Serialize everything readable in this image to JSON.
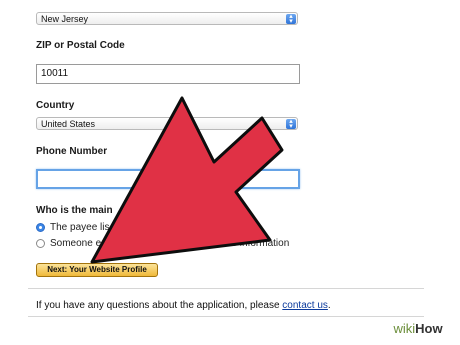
{
  "form": {
    "state_select": {
      "value": "New Jersey"
    },
    "zip": {
      "label": "ZIP or Postal Code",
      "value": "10011"
    },
    "country": {
      "label": "Country",
      "value": "United States"
    },
    "phone": {
      "label": "Phone Number",
      "value": ""
    },
    "question": {
      "label": "Who is the main"
    },
    "options": [
      {
        "label": "The payee lis",
        "selected": true
      },
      {
        "label": "Someone e",
        "suffix": "enter their information",
        "selected": false
      }
    ],
    "next_button": "Next: Your Website Profile"
  },
  "footer": {
    "text_before": "If you have any questions about the application, please ",
    "link": "contact us",
    "text_after": "."
  },
  "overlay": {
    "arrow_color": "#e03145",
    "arrow_outline": "#0d0d0d"
  },
  "watermark": {
    "part1": "wiki",
    "part2": "How"
  }
}
